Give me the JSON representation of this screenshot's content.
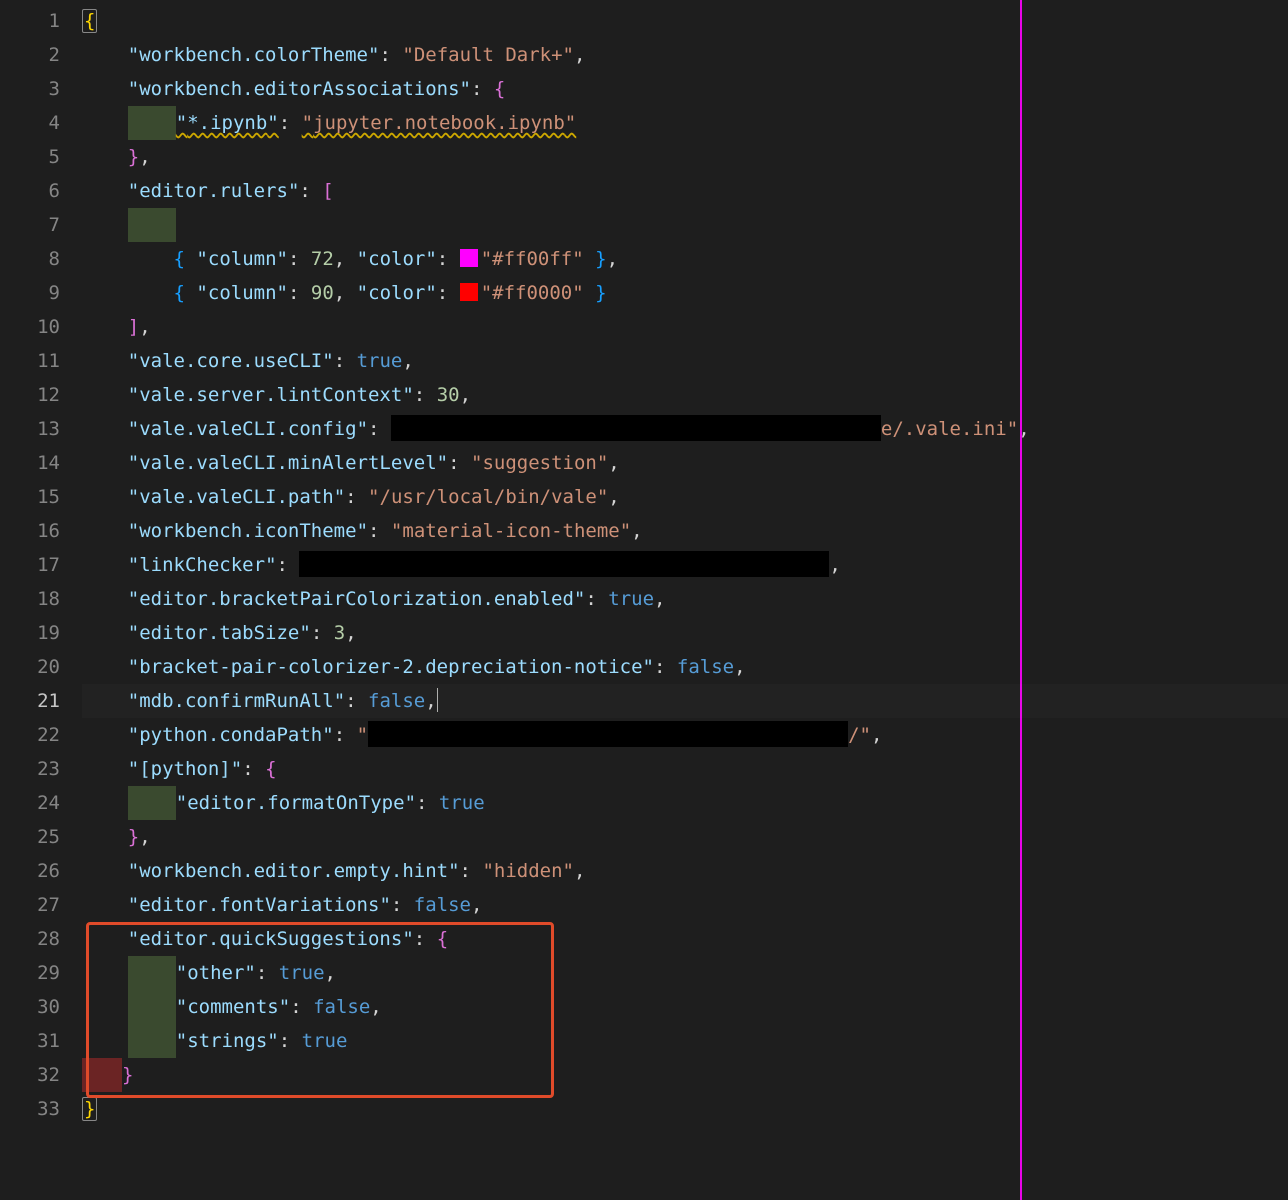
{
  "lineNumbers": [
    "1",
    "2",
    "3",
    "4",
    "5",
    "6",
    "7",
    "8",
    "9",
    "10",
    "11",
    "12",
    "13",
    "14",
    "15",
    "16",
    "17",
    "18",
    "19",
    "20",
    "21",
    "22",
    "23",
    "24",
    "25",
    "26",
    "27",
    "28",
    "29",
    "30",
    "31",
    "32",
    "33"
  ],
  "activeLine": 21,
  "rulerColumn": 90,
  "tokens": {
    "openBrace": "{",
    "closeBrace": "}",
    "openBracket": "[",
    "closeBracket": "]",
    "comma": ",",
    "colon": ":",
    "quote": "\"",
    "k_colorTheme": "workbench.colorTheme",
    "v_colorTheme": "Default Dark+",
    "k_editorAssoc": "workbench.editorAssociations",
    "k_ipynb": "*.ipynb",
    "v_ipynb": "jupyter.notebook.ipynb",
    "k_rulers": "editor.rulers",
    "k_column": "column",
    "v_col72": "72",
    "v_col90": "90",
    "k_color": "color",
    "v_magenta": "#ff00ff",
    "v_red": "#ff0000",
    "k_valeUseCLI": "vale.core.useCLI",
    "v_true": "true",
    "v_false": "false",
    "k_valeLint": "vale.server.lintContext",
    "v_30": "30",
    "k_valeConfig": "vale.valeCLI.config",
    "v_valeConfigTail": "e/.vale.ini",
    "k_valeMinAlert": "vale.valeCLI.minAlertLevel",
    "v_suggestion": "suggestion",
    "k_valePath": "vale.valeCLI.path",
    "v_valePath": "/usr/local/bin/vale",
    "k_iconTheme": "workbench.iconTheme",
    "v_iconTheme": "material-icon-theme",
    "k_linkChecker": "linkChecker",
    "k_bracketColor": "editor.bracketPairColorization.enabled",
    "k_tabSize": "editor.tabSize",
    "v_3": "3",
    "k_bp2notice": "bracket-pair-colorizer-2.depreciation-notice",
    "k_mdbConfirm": "mdb.confirmRunAll",
    "k_condaPath": "python.condaPath",
    "v_condaTail": "/",
    "k_pythonSect": "[python]",
    "k_formatOnType": "editor.formatOnType",
    "k_emptyHint": "workbench.editor.empty.hint",
    "v_hidden": "hidden",
    "k_fontVar": "editor.fontVariations",
    "k_quickSugg": "editor.quickSuggestions",
    "k_other": "other",
    "k_comments": "comments",
    "k_strings": "strings"
  },
  "redactions": {
    "r13": 490,
    "r17": 530,
    "r22": 480
  },
  "colorSwatches": {
    "magenta": "#ff00ff",
    "red": "#ff0000"
  },
  "highlightBox": {
    "startLine": 28,
    "endLine": 32
  }
}
